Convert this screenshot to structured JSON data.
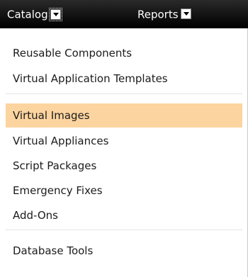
{
  "nav": {
    "catalog_label": "Catalog",
    "reports_label": "Reports"
  },
  "menu": {
    "groups": [
      {
        "items": [
          "Reusable Components",
          "Virtual Application Templates"
        ]
      },
      {
        "items": [
          "Virtual Images",
          "Virtual Appliances",
          "Script Packages",
          "Emergency Fixes",
          "Add-Ons"
        ]
      },
      {
        "items": [
          "Database Tools"
        ]
      }
    ],
    "selected_item": "Virtual Images",
    "selected_color": "#fcd49f"
  }
}
